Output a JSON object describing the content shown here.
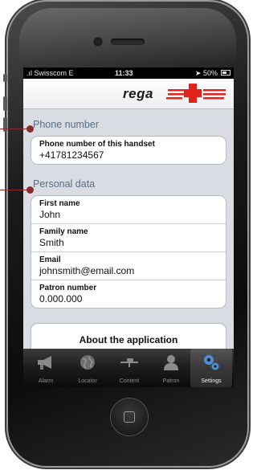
{
  "status_bar": {
    "carrier": "Swisscom",
    "network": "E",
    "time": "11:33",
    "battery": "50%"
  },
  "app": {
    "brand": "rega"
  },
  "sections": [
    {
      "title": "Phone number",
      "fields": [
        {
          "label": "Phone number of this handset",
          "value": "+41781234567"
        }
      ]
    },
    {
      "title": "Personal data",
      "fields": [
        {
          "label": "First name",
          "value": "John"
        },
        {
          "label": "Family name",
          "value": "Smith"
        },
        {
          "label": "Email",
          "value": "johnsmith@email.com"
        },
        {
          "label": "Patron number",
          "value": "0.000.000"
        }
      ]
    }
  ],
  "about_button": "About the application",
  "tabs": [
    {
      "label": "Alarm",
      "icon": "megaphone-icon"
    },
    {
      "label": "Locator",
      "icon": "globe-icon"
    },
    {
      "label": "Content",
      "icon": "helicopter-icon"
    },
    {
      "label": "Patron",
      "icon": "person-icon"
    },
    {
      "label": "Settings",
      "icon": "gears-icon",
      "active": true
    }
  ],
  "colors": {
    "accent_red": "#e0231b",
    "section_title": "#5b6e83",
    "callout": "#8b2c2c"
  }
}
